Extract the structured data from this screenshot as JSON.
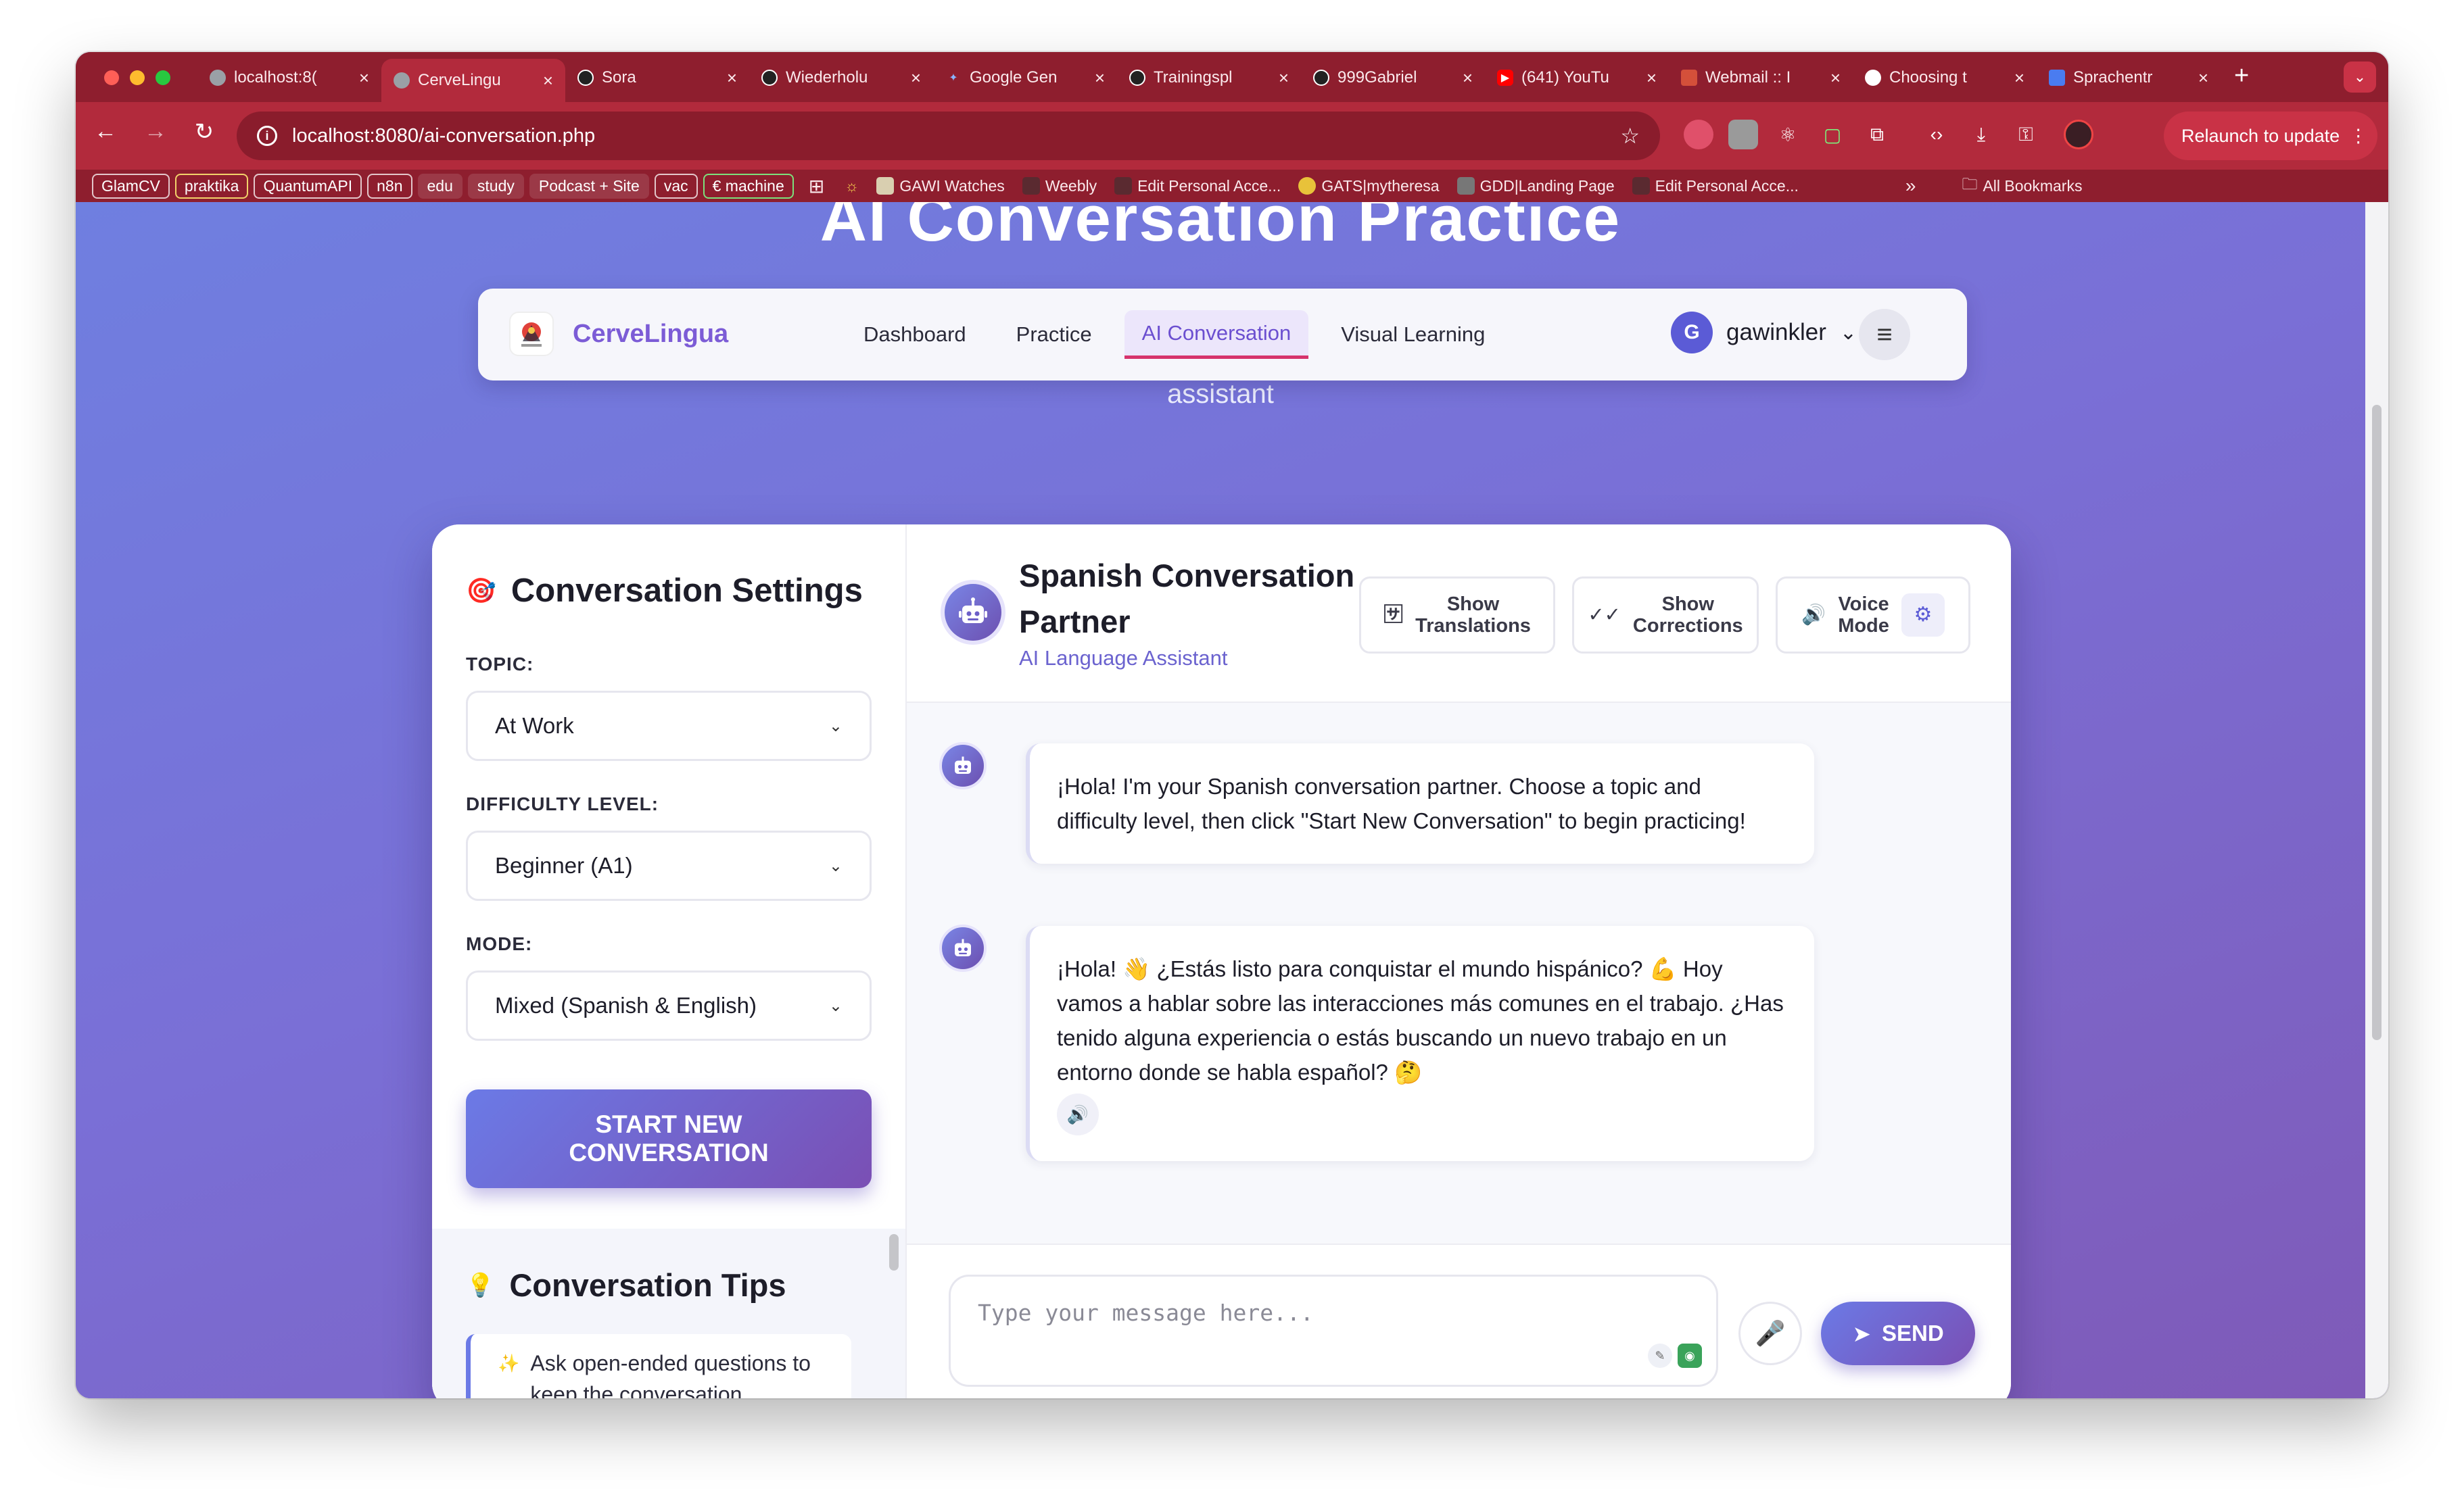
{
  "browser": {
    "tabs": [
      {
        "title": "localhost:8(",
        "color": "#9aa0a6"
      },
      {
        "title": "CerveLingu",
        "color": "#9aa0a6"
      },
      {
        "title": "Sora",
        "color": "#222222"
      },
      {
        "title": "Wiederholu",
        "color": "#222222"
      },
      {
        "title": "Google Gen",
        "color": "#4a7cf0"
      },
      {
        "title": "Trainingspl",
        "color": "#222222"
      },
      {
        "title": "999Gabriel",
        "color": "#222222"
      },
      {
        "title": "(641) YouTu",
        "color": "#ff0000"
      },
      {
        "title": "Webmail :: I",
        "color": "#d4503a"
      },
      {
        "title": "Choosing t",
        "color": "#222222"
      },
      {
        "title": "Sprachentr",
        "color": "#4a7cf0"
      }
    ],
    "url": "localhost:8080/ai-conversation.php",
    "relaunch_label": "Relaunch to update",
    "bookmarks_chips": [
      "GlamCV",
      "praktika",
      "QuantumAPI",
      "n8n",
      "edu",
      "study",
      "Podcast + Site",
      "vac",
      "€ machine"
    ],
    "bookmarks_items": [
      "GAWI Watches",
      "Weebly",
      "Edit Personal Acce...",
      "GATS|mytheresa",
      "GDD|Landing Page",
      "Edit Personal Acce..."
    ],
    "all_bookmarks": "All Bookmarks"
  },
  "page": {
    "bg_title": "AI Conversation Practice",
    "subtitle": "assistant"
  },
  "nav": {
    "brand": "CerveLingua",
    "links": [
      "Dashboard",
      "Practice",
      "AI Conversation",
      "Visual Learning"
    ],
    "active_link": "AI Conversation",
    "user_initial": "G",
    "username": "gawinkler"
  },
  "settings": {
    "title": "Conversation Settings",
    "topic_label": "TOPIC:",
    "topic_value": "At Work",
    "difficulty_label": "DIFFICULTY LEVEL:",
    "difficulty_value": "Beginner (A1)",
    "mode_label": "MODE:",
    "mode_value": "Mixed (Spanish & English)",
    "start_line1": "START NEW",
    "start_line2": "CONVERSATION"
  },
  "tips": {
    "title": "Conversation Tips",
    "items": [
      "Ask open-ended questions to keep the conversation"
    ]
  },
  "chat": {
    "partner_line1": "Spanish Conversation",
    "partner_line2": "Partner",
    "assistant_label": "AI Language Assistant",
    "buttons": {
      "translations_1": "Show",
      "translations_2": "Translations",
      "corrections_1": "Show",
      "corrections_2": "Corrections",
      "voice_1": "Voice",
      "voice_2": "Mode"
    },
    "messages": [
      "¡Hola! I'm your Spanish conversation partner. Choose a topic and difficulty level, then click \"Start New Conversation\" to begin practicing!",
      "¡Hola! 👋 ¿Estás listo para conquistar el mundo hispánico? 💪 Hoy vamos a hablar sobre las interacciones más comunes en el trabajo. ¿Has tenido alguna experiencia o estás buscando un nuevo trabajo en un entorno donde se habla español? 🤔"
    ],
    "input_placeholder": "Type your message here...",
    "send_label": "SEND"
  }
}
